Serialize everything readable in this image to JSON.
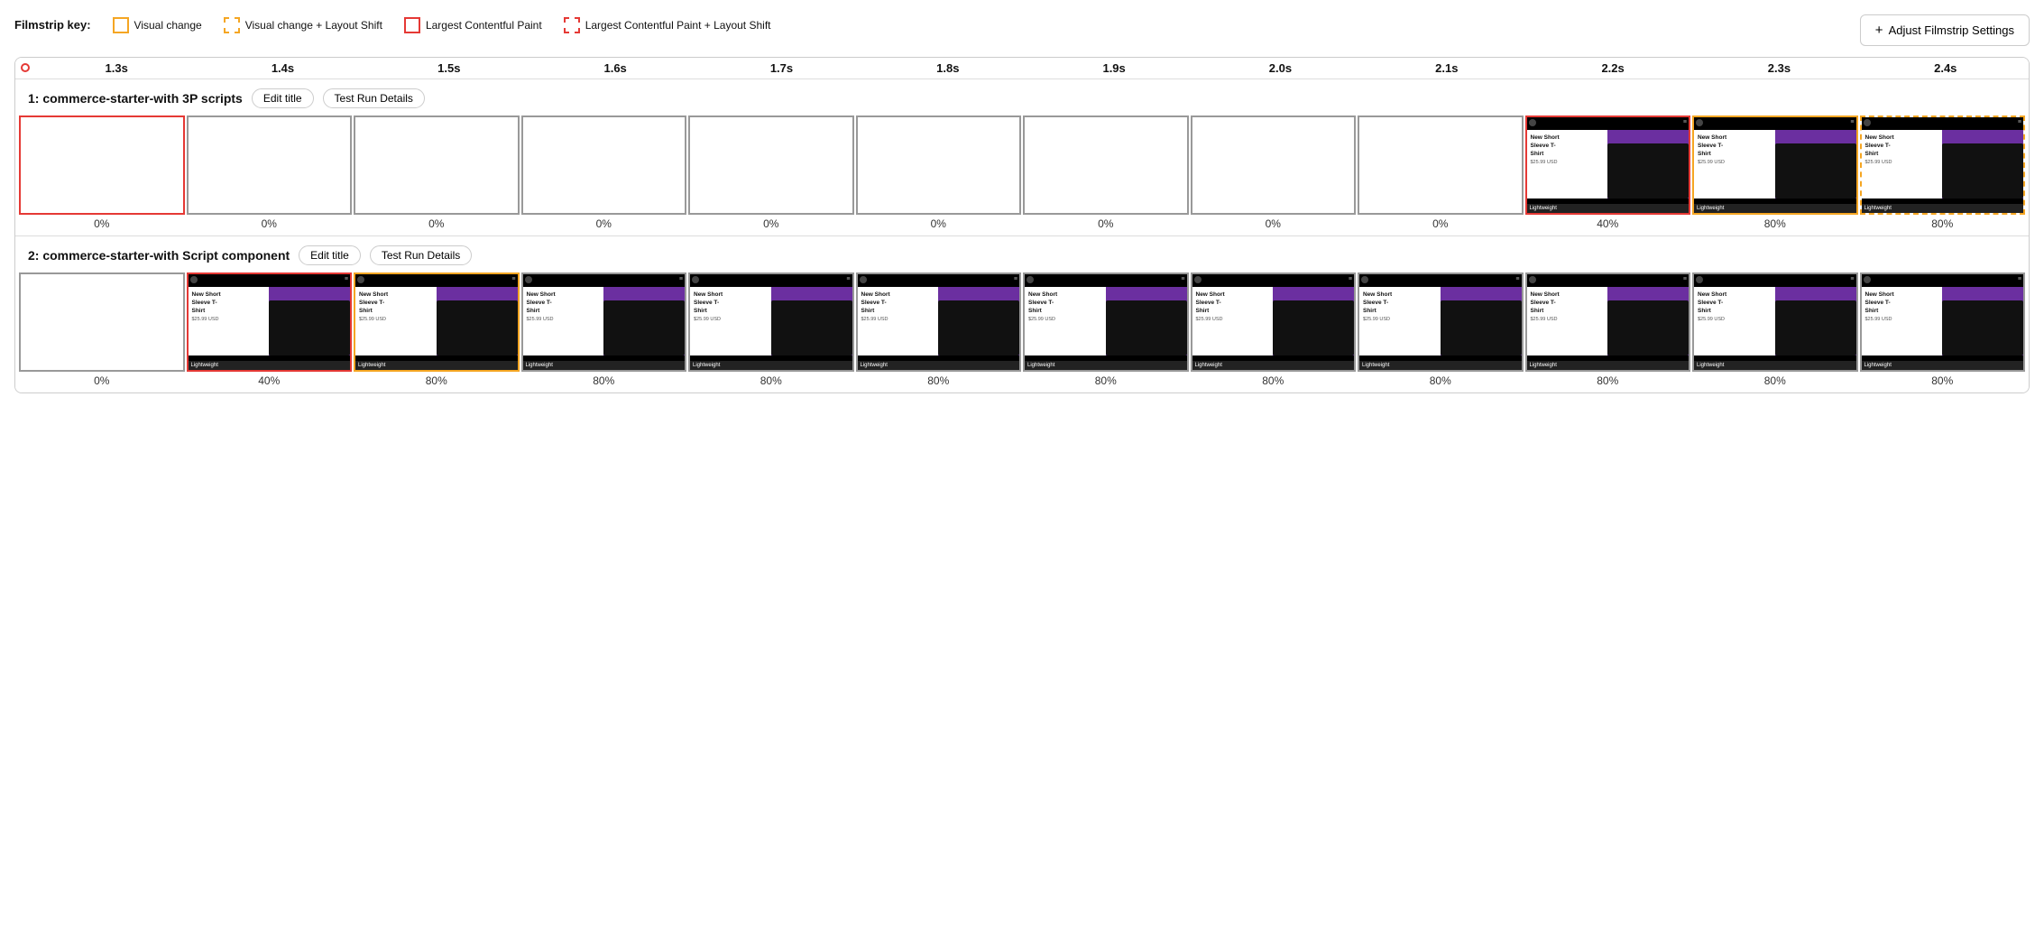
{
  "legend": {
    "label": "Filmstrip key:",
    "items": [
      {
        "id": "visual-change",
        "label": "Visual change",
        "swatch": "yellow-solid"
      },
      {
        "id": "visual-change-layout-shift",
        "label": "Visual change + Layout Shift",
        "swatch": "yellow-dashed"
      },
      {
        "id": "lcp",
        "label": "Largest Contentful Paint",
        "swatch": "red-solid"
      },
      {
        "id": "lcp-layout-shift",
        "label": "Largest Contentful Paint + Layout Shift",
        "swatch": "red-dashed"
      }
    ]
  },
  "adjustBtn": "Adjust Filmstrip Settings",
  "timeline": {
    "ticks": [
      "1.3s",
      "1.4s",
      "1.5s",
      "1.6s",
      "1.7s",
      "1.8s",
      "1.9s",
      "2.0s",
      "2.1s",
      "2.2s",
      "2.3s",
      "2.4s"
    ]
  },
  "runs": [
    {
      "id": "run1",
      "title": "1: commerce-starter-with 3P scripts",
      "editTitleLabel": "Edit title",
      "testRunLabel": "Test Run Details",
      "frames": [
        {
          "border": "red-solid",
          "blank": true,
          "pct": "0%"
        },
        {
          "border": "none",
          "blank": true,
          "pct": "0%"
        },
        {
          "border": "none",
          "blank": true,
          "pct": "0%"
        },
        {
          "border": "none",
          "blank": true,
          "pct": "0%"
        },
        {
          "border": "none",
          "blank": true,
          "pct": "0%"
        },
        {
          "border": "none",
          "blank": true,
          "pct": "0%"
        },
        {
          "border": "none",
          "blank": true,
          "pct": "0%"
        },
        {
          "border": "none",
          "blank": true,
          "pct": "0%"
        },
        {
          "border": "none",
          "blank": true,
          "pct": "0%"
        },
        {
          "border": "red-solid",
          "blank": false,
          "pct": "40%"
        },
        {
          "border": "yellow-solid",
          "blank": false,
          "pct": "80%"
        },
        {
          "border": "yellow-dashed",
          "blank": false,
          "pct": "80%"
        }
      ]
    },
    {
      "id": "run2",
      "title": "2: commerce-starter-with Script component",
      "editTitleLabel": "Edit title",
      "testRunLabel": "Test Run Details",
      "frames": [
        {
          "border": "none",
          "blank": true,
          "pct": "0%"
        },
        {
          "border": "red-solid",
          "blank": false,
          "pct": "40%"
        },
        {
          "border": "yellow-solid",
          "blank": false,
          "pct": "80%"
        },
        {
          "border": "none",
          "blank": false,
          "pct": "80%"
        },
        {
          "border": "none",
          "blank": false,
          "pct": "80%"
        },
        {
          "border": "none",
          "blank": false,
          "pct": "80%"
        },
        {
          "border": "none",
          "blank": false,
          "pct": "80%"
        },
        {
          "border": "none",
          "blank": false,
          "pct": "80%"
        },
        {
          "border": "none",
          "blank": false,
          "pct": "80%"
        },
        {
          "border": "none",
          "blank": false,
          "pct": "80%"
        },
        {
          "border": "none",
          "blank": false,
          "pct": "80%"
        },
        {
          "border": "none",
          "blank": false,
          "pct": "80%"
        }
      ]
    }
  ],
  "thumbContent": {
    "title": "New Short Sleeve T-Shirt",
    "price": "$25.99 USD",
    "badge": "Lightweight"
  }
}
